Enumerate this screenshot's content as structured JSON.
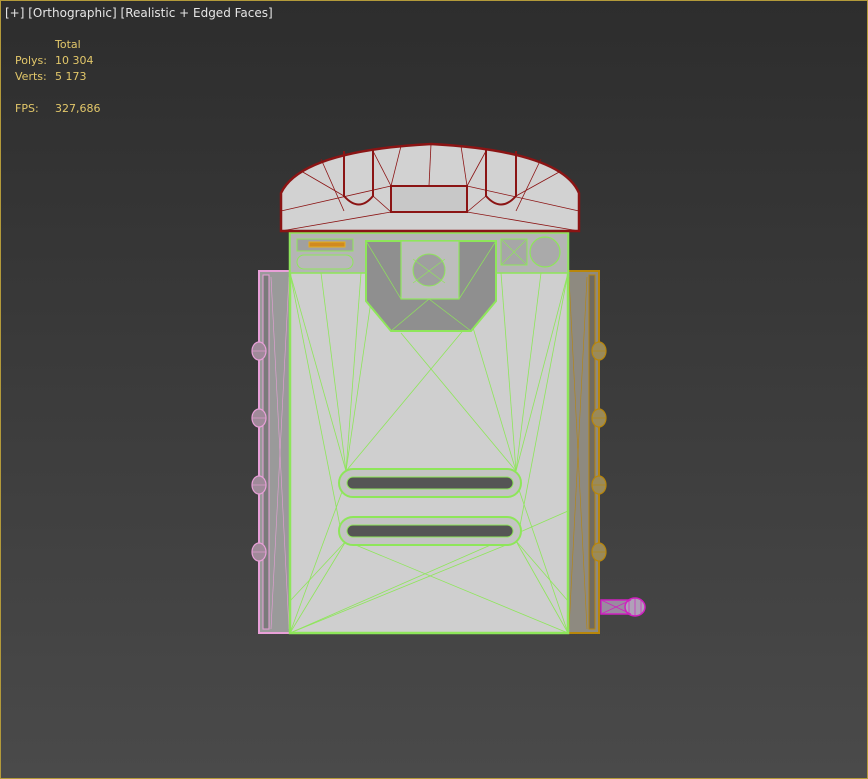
{
  "viewport": {
    "menu_plus": "[+]",
    "view_mode": "[Orthographic]",
    "shading_mode": "[Realistic + Edged Faces]"
  },
  "stats": {
    "header": "Total",
    "polys_label": "Polys:",
    "polys_value": "10 304",
    "verts_label": "Verts:",
    "verts_value": "5 173",
    "fps_label": "FPS:",
    "fps_value": "327,686"
  },
  "colors": {
    "border": "#b39a3a",
    "stats_text": "#e2c76a",
    "body_wire": "#8ee65a",
    "handset_wire": "#8b1414",
    "left_panel_wire": "#e8a0d8",
    "right_panel_wire": "#b8860b",
    "knob_wire": "#d020c0"
  }
}
